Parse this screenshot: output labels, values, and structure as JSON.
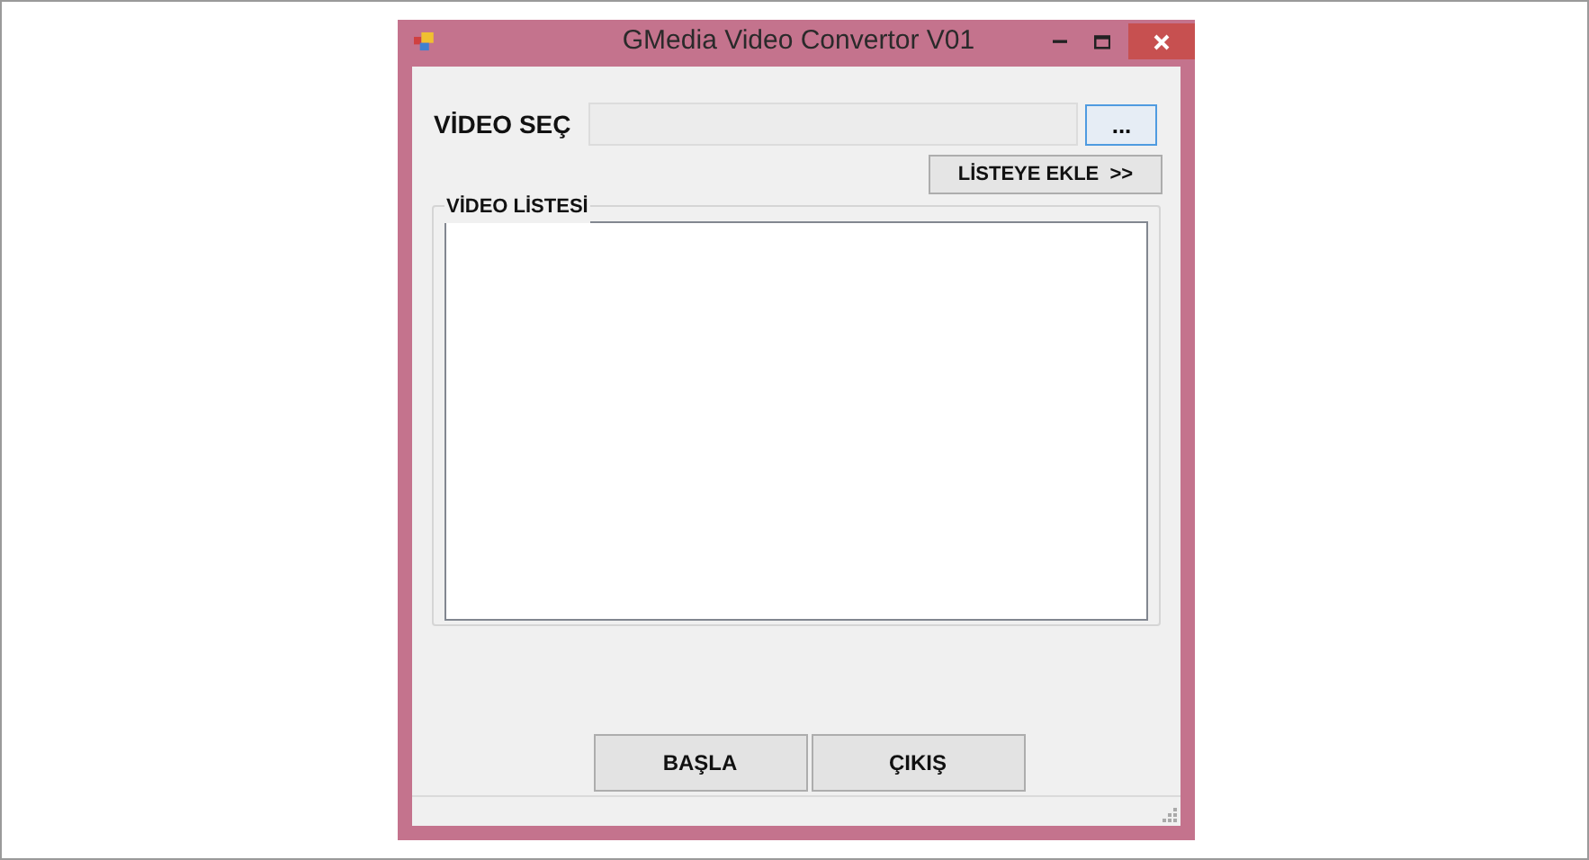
{
  "window": {
    "title": "GMedia Video Convertor V01"
  },
  "video_select": {
    "label": "VİDEO SEÇ",
    "browse_button": "..."
  },
  "add_button": "LİSTEYE EKLE  >>",
  "video_list": {
    "title": "VİDEO LİSTESİ"
  },
  "buttons": [
    "BAŞLA",
    "ÇIKIŞ"
  ]
}
